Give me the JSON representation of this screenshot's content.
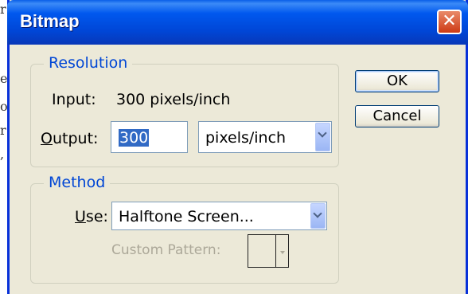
{
  "background_fragments": [
    "r",
    "e",
    "o",
    "r",
    ","
  ],
  "dialog": {
    "title": "Bitmap",
    "close_glyph": "✕"
  },
  "resolution": {
    "legend": "Resolution",
    "input_label": "Input:",
    "input_value": "300 pixels/inch",
    "output_label_u": "O",
    "output_label_rest": "utput:",
    "output_value": "300",
    "unit_selected": "pixels/inch"
  },
  "method": {
    "legend": "Method",
    "use_label_u": "U",
    "use_label_rest": "se:",
    "use_selected": "Halftone Screen...",
    "custom_pattern_label": "Custom Pattern:"
  },
  "buttons": {
    "ok": "OK",
    "cancel": "Cancel"
  },
  "icons": [
    "close-icon",
    "chevron-down-icon"
  ]
}
